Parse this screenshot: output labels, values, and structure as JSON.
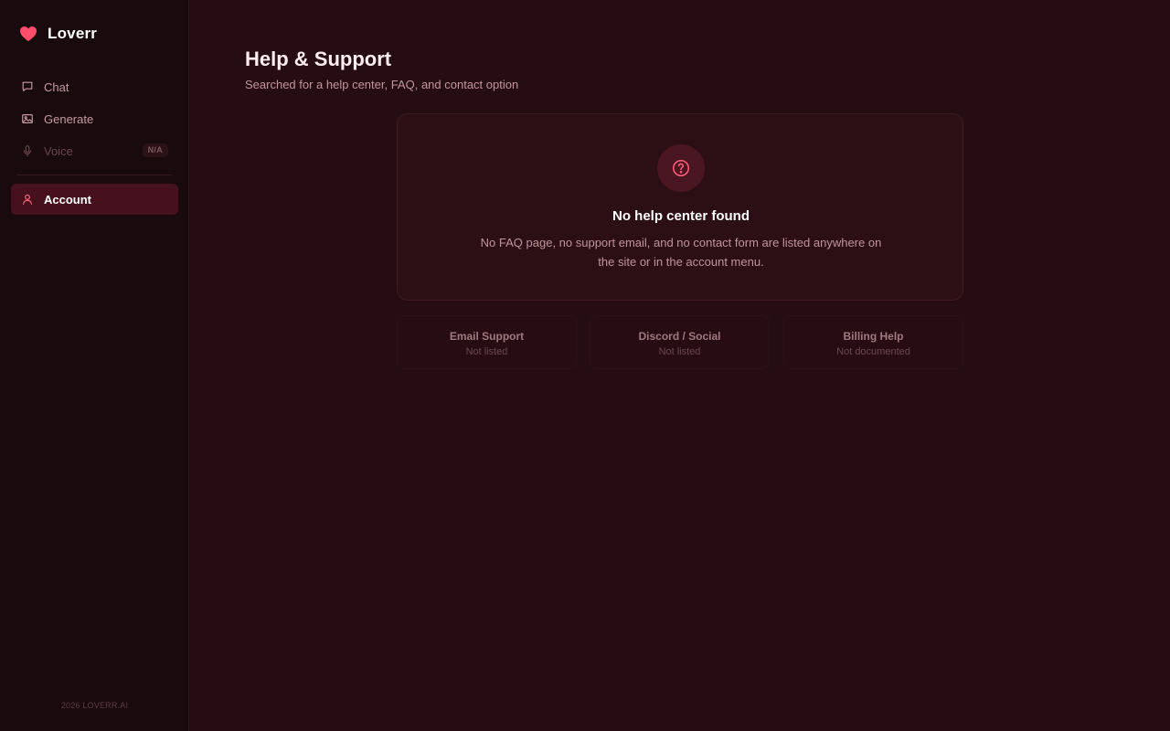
{
  "brand": {
    "name": "Loverr",
    "icon": "heart-icon",
    "accent": "#ff4d6a"
  },
  "sidebar": {
    "items": [
      {
        "label": "Chat",
        "icon": "chat-bubble-icon"
      },
      {
        "label": "Generate",
        "icon": "image-icon"
      },
      {
        "label": "Voice",
        "icon": "microphone-icon",
        "badge": "N/A",
        "disabled": true
      },
      {
        "label": "Account",
        "icon": "user-icon",
        "active": true
      }
    ],
    "footer": "2026 LOVERR.AI"
  },
  "main": {
    "title": "Help & Support",
    "subtitle": "Searched for a help center, FAQ, and contact option",
    "empty_state": {
      "icon": "question-circle-icon",
      "title": "No help center found",
      "description": "No FAQ page, no support email, and no contact form are listed anywhere on the site or in the account menu."
    },
    "info_cards": [
      {
        "title": "Email Support",
        "status": "Not listed"
      },
      {
        "title": "Discord / Social",
        "status": "Not listed"
      },
      {
        "title": "Billing Help",
        "status": "Not documented"
      }
    ]
  },
  "colors": {
    "background": "#260d13",
    "sidebar": "#190a0d",
    "active_item": "#47101d",
    "accent": "#ff4d6a"
  }
}
